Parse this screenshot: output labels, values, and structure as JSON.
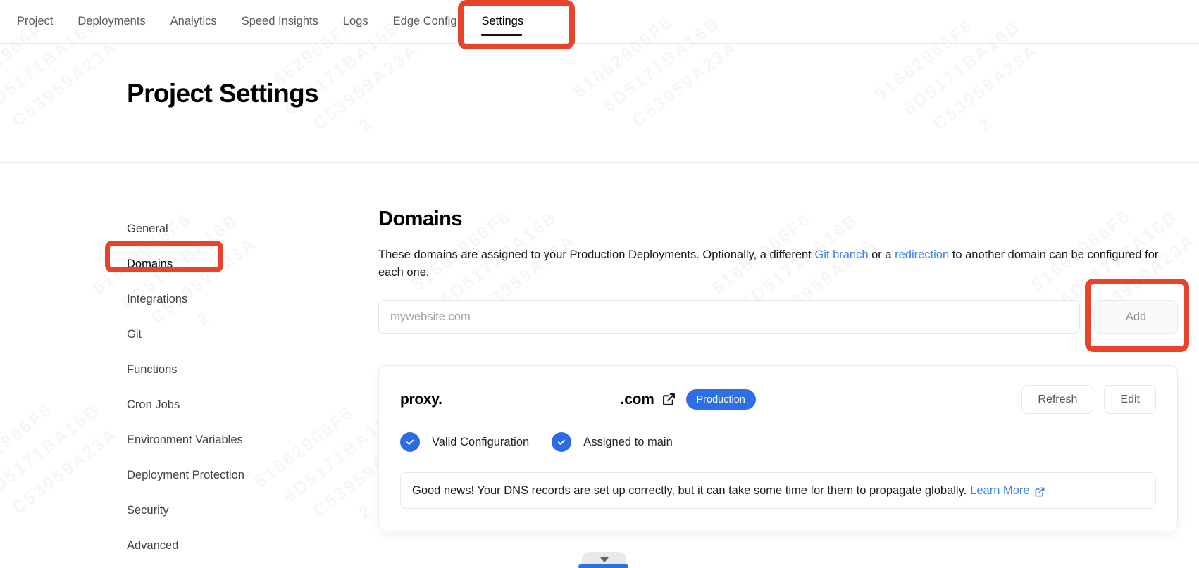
{
  "nav": {
    "items": [
      {
        "label": "Project"
      },
      {
        "label": "Deployments"
      },
      {
        "label": "Analytics"
      },
      {
        "label": "Speed Insights"
      },
      {
        "label": "Logs"
      },
      {
        "label": "Edge Config"
      },
      {
        "label": "Settings"
      }
    ],
    "active_item": "Settings"
  },
  "page": {
    "title": "Project Settings"
  },
  "sidebar": {
    "items": [
      {
        "label": "General"
      },
      {
        "label": "Domains"
      },
      {
        "label": "Integrations"
      },
      {
        "label": "Git"
      },
      {
        "label": "Functions"
      },
      {
        "label": "Cron Jobs"
      },
      {
        "label": "Environment Variables"
      },
      {
        "label": "Deployment Protection"
      },
      {
        "label": "Security"
      },
      {
        "label": "Advanced"
      }
    ],
    "active_item": "Domains"
  },
  "domains_section": {
    "heading": "Domains",
    "description": {
      "part1": "These domains are assigned to your Production Deployments. Optionally, a different ",
      "link1": "Git branch",
      "part2": " or a ",
      "link2": "redirection",
      "part3": " to another domain can be configured for each one."
    },
    "add_form": {
      "input_value": "",
      "input_placeholder": "mywebsite.com",
      "add_button": "Add"
    },
    "domain_card": {
      "name_visible_start": "proxy.",
      "name_visible_end": ".com",
      "badge": "Production",
      "refresh_button": "Refresh",
      "edit_button": "Edit",
      "statuses": [
        {
          "label": "Valid Configuration"
        },
        {
          "label": "Assigned to main"
        }
      ],
      "notice": {
        "text": "Good news! Your DNS records are set up correctly, but it can take some time for them to propagate globally.",
        "link": "Learn More"
      }
    }
  },
  "colors": {
    "annotation_red": "#e8432b",
    "accent_blue": "#2e6fe6",
    "link_blue": "#3b7ef2"
  },
  "watermark": {
    "lines": [
      "51662966F6",
      "6D5171BA16B",
      "C53959A23A",
      "2"
    ]
  }
}
